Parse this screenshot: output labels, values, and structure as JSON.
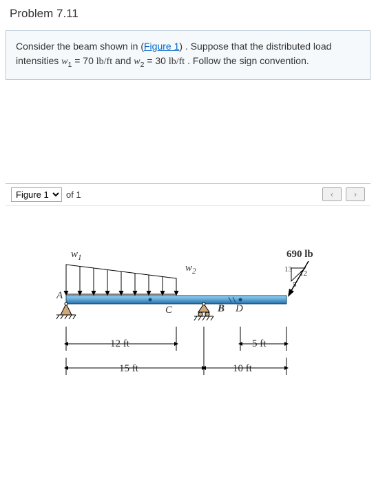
{
  "header": {
    "title": "Problem 7.11"
  },
  "problem": {
    "pre": "Consider the beam shown in (",
    "figlink": "Figure 1",
    "mid1": ") . Suppose that the distributed load intensities ",
    "w1sym": "w",
    "w1sub": "1",
    "eq1": " = 70  ",
    "unit1": "lb/ft",
    "mid2": " and ",
    "w2sym": "w",
    "w2sub": "2",
    "eq2": " = 30  ",
    "unit2": "lb/ft",
    "tail": " . Follow the sign convention."
  },
  "figurebar": {
    "selected": "Figure 1",
    "of": "of 1",
    "prev": "‹",
    "next": "›"
  },
  "diagram": {
    "w1": "w",
    "w1s": "1",
    "w2": "w",
    "w2s": "2",
    "ptA": "A",
    "ptB": "B",
    "ptC": "C",
    "ptD": "D",
    "load": "690 lb",
    "tri13": "13",
    "tri12": "12",
    "tri5": "5",
    "d12": "12 ft",
    "d5": "5 ft",
    "d15": "15 ft",
    "d10": "10 ft"
  },
  "chart_data": {
    "type": "diagram",
    "description": "Simply supported beam with overhang; distributed triangular load w1 to w2 over AC, point load 690 lb at right end with 5-12-13 slope.",
    "w1_lb_per_ft": 70,
    "w2_lb_per_ft": 30,
    "point_load_lb": 690,
    "point_load_slope": {
      "h": 12,
      "v": 5,
      "hyp": 13
    },
    "spans_ft": {
      "A_to_C": 12,
      "A_to_B": 15,
      "B_to_end": 10,
      "D_to_end": 5
    },
    "supports": {
      "A": "pin",
      "B": "roller"
    }
  }
}
